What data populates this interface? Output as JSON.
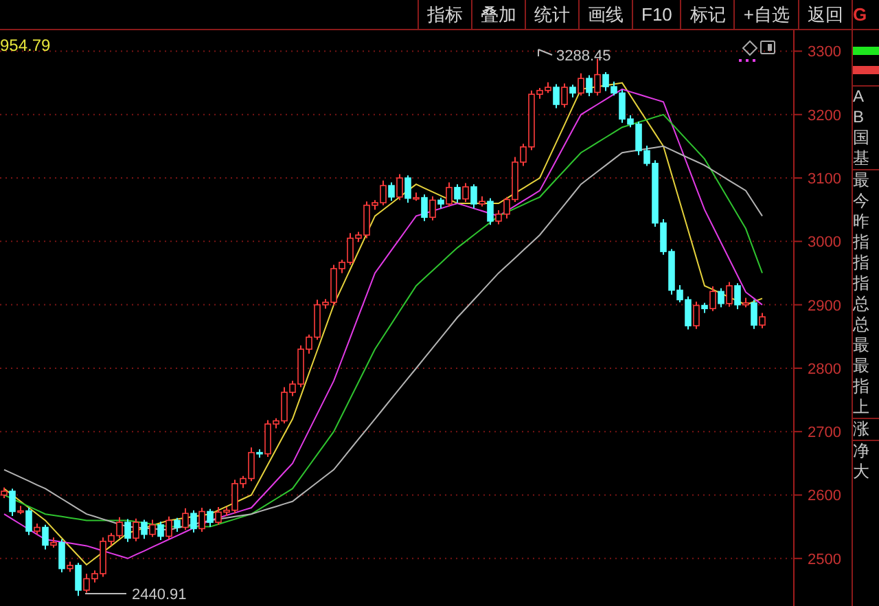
{
  "toolbar": {
    "buttons": [
      "指标",
      "叠加",
      "统计",
      "画线",
      "F10",
      "标记",
      "+自选",
      "返回"
    ]
  },
  "chart": {
    "last_value": "954.79",
    "high_label": "3288.45",
    "low_label": "2440.91",
    "chart_data": {
      "type": "candlestick",
      "grid": true,
      "ylim": [
        2425,
        3333
      ],
      "yticks": [
        {
          "value": 3300,
          "label": "3300"
        },
        {
          "value": 3200,
          "label": "3200"
        },
        {
          "value": 3100,
          "label": "3100"
        },
        {
          "value": 3000,
          "label": "3000"
        },
        {
          "value": 2900,
          "label": "2900"
        },
        {
          "value": 2800,
          "label": "2800"
        },
        {
          "value": 2700,
          "label": "2700"
        },
        {
          "value": 2600,
          "label": "2600"
        },
        {
          "value": 2500,
          "label": "2500"
        }
      ],
      "categories": [
        null,
        null,
        null,
        null,
        null,
        null,
        null,
        null,
        null,
        null,
        null,
        null,
        null,
        null,
        null,
        null,
        null,
        null,
        null,
        null,
        null,
        null,
        null,
        null,
        null,
        null,
        null,
        null,
        null,
        null,
        null,
        null,
        null,
        null,
        null,
        null,
        null,
        null,
        null,
        null,
        null,
        null,
        null,
        null,
        null,
        null,
        null,
        null,
        null,
        null,
        null,
        null,
        null,
        null,
        null,
        null,
        null,
        null,
        null,
        null,
        null,
        null,
        null,
        null,
        null,
        null,
        null,
        null,
        null,
        null,
        null,
        null,
        null,
        null,
        null,
        null,
        null,
        null,
        null,
        null,
        null,
        null,
        null,
        null,
        null,
        null,
        null,
        null,
        null,
        null,
        null,
        null,
        null
      ],
      "ohlc": [
        [
          2600,
          2612,
          2595,
          2606
        ],
        [
          2606,
          2610,
          2567,
          2574
        ],
        [
          2574,
          2583,
          2570,
          2575
        ],
        [
          2575,
          2580,
          2537,
          2543
        ],
        [
          2543,
          2555,
          2538,
          2549
        ],
        [
          2549,
          2553,
          2514,
          2521
        ],
        [
          2521,
          2533,
          2517,
          2525
        ],
        [
          2525,
          2530,
          2478,
          2484
        ],
        [
          2484,
          2495,
          2479,
          2489
        ],
        [
          2489,
          2493,
          2441,
          2450
        ],
        [
          2450,
          2476,
          2446,
          2468
        ],
        [
          2468,
          2481,
          2462,
          2476
        ],
        [
          2476,
          2533,
          2471,
          2527
        ],
        [
          2527,
          2540,
          2520,
          2536
        ],
        [
          2536,
          2565,
          2532,
          2557
        ],
        [
          2557,
          2562,
          2526,
          2532
        ],
        [
          2532,
          2563,
          2527,
          2557
        ],
        [
          2557,
          2561,
          2531,
          2538
        ],
        [
          2538,
          2561,
          2534,
          2553
        ],
        [
          2553,
          2558,
          2529,
          2535
        ],
        [
          2535,
          2566,
          2530,
          2560
        ],
        [
          2560,
          2564,
          2542,
          2549
        ],
        [
          2549,
          2579,
          2545,
          2571
        ],
        [
          2571,
          2576,
          2541,
          2547
        ],
        [
          2547,
          2580,
          2542,
          2574
        ],
        [
          2574,
          2578,
          2550,
          2557
        ],
        [
          2557,
          2581,
          2553,
          2573
        ],
        [
          2573,
          2581,
          2567,
          2576
        ],
        [
          2576,
          2624,
          2571,
          2618
        ],
        [
          2618,
          2630,
          2611,
          2626
        ],
        [
          2626,
          2675,
          2622,
          2667
        ],
        [
          2667,
          2672,
          2659,
          2665
        ],
        [
          2665,
          2718,
          2660,
          2712
        ],
        [
          2712,
          2721,
          2705,
          2717
        ],
        [
          2717,
          2770,
          2713,
          2762
        ],
        [
          2762,
          2780,
          2756,
          2775
        ],
        [
          2775,
          2836,
          2770,
          2830
        ],
        [
          2830,
          2853,
          2823,
          2849
        ],
        [
          2849,
          2908,
          2845,
          2900
        ],
        [
          2900,
          2909,
          2894,
          2904
        ],
        [
          2904,
          2963,
          2899,
          2957
        ],
        [
          2957,
          2971,
          2950,
          2967
        ],
        [
          2967,
          3013,
          2963,
          3005
        ],
        [
          3005,
          3015,
          2999,
          3010
        ],
        [
          3010,
          3063,
          3005,
          3057
        ],
        [
          3057,
          3065,
          3050,
          3061
        ],
        [
          3061,
          3096,
          3057,
          3088
        ],
        [
          3088,
          3093,
          3064,
          3070
        ],
        [
          3070,
          3106,
          3065,
          3100
        ],
        [
          3100,
          3104,
          3061,
          3068
        ],
        [
          3068,
          3077,
          3064,
          3069
        ],
        [
          3069,
          3074,
          3032,
          3038
        ],
        [
          3038,
          3071,
          3033,
          3065
        ],
        [
          3065,
          3069,
          3052,
          3059
        ],
        [
          3059,
          3093,
          3055,
          3085
        ],
        [
          3085,
          3090,
          3061,
          3067
        ],
        [
          3067,
          3092,
          3062,
          3086
        ],
        [
          3086,
          3090,
          3052,
          3059
        ],
        [
          3059,
          3071,
          3055,
          3063
        ],
        [
          3063,
          3068,
          3026,
          3032
        ],
        [
          3032,
          3049,
          3027,
          3043
        ],
        [
          3043,
          3070,
          3036,
          3066
        ],
        [
          3066,
          3133,
          3062,
          3125
        ],
        [
          3125,
          3154,
          3119,
          3149
        ],
        [
          3149,
          3238,
          3144,
          3232
        ],
        [
          3232,
          3242,
          3225,
          3238
        ],
        [
          3238,
          3251,
          3234,
          3243
        ],
        [
          3243,
          3248,
          3210,
          3216
        ],
        [
          3216,
          3249,
          3211,
          3243
        ],
        [
          3243,
          3247,
          3227,
          3234
        ],
        [
          3234,
          3265,
          3230,
          3257
        ],
        [
          3257,
          3262,
          3229,
          3235
        ],
        [
          3235,
          3288,
          3230,
          3263
        ],
        [
          3263,
          3267,
          3237,
          3244
        ],
        [
          3244,
          3252,
          3230,
          3234
        ],
        [
          3234,
          3239,
          3187,
          3193
        ],
        [
          3193,
          3199,
          3180,
          3185
        ],
        [
          3185,
          3189,
          3136,
          3143
        ],
        [
          3143,
          3151,
          3119,
          3123
        ],
        [
          3123,
          3128,
          3023,
          3029
        ],
        [
          3029,
          3035,
          2979,
          2984
        ],
        [
          2984,
          2988,
          2916,
          2923
        ],
        [
          2923,
          2931,
          2904,
          2908
        ],
        [
          2908,
          2913,
          2861,
          2867
        ],
        [
          2867,
          2905,
          2862,
          2899
        ],
        [
          2899,
          2903,
          2887,
          2894
        ],
        [
          2894,
          2929,
          2890,
          2921
        ],
        [
          2921,
          2926,
          2896,
          2902
        ],
        [
          2902,
          2936,
          2897,
          2930
        ],
        [
          2930,
          2934,
          2893,
          2900
        ],
        [
          2900,
          2911,
          2896,
          2903
        ],
        [
          2903,
          2908,
          2862,
          2868
        ],
        [
          2868,
          2887,
          2863,
          2881
        ]
      ],
      "series": [
        {
          "type": "line",
          "color": "#e6d23c",
          "values": [
            2610,
            2600,
            2590,
            2580,
            2570,
            2560,
            2546,
            2532,
            2518,
            2504,
            2490,
            2500,
            2510,
            2520,
            2530,
            2540,
            2544,
            2548,
            2552,
            2556,
            2560,
            2562,
            2564,
            2566,
            2568,
            2570,
            2576,
            2582,
            2588,
            2594,
            2600,
            2624,
            2648,
            2672,
            2696,
            2720,
            2756,
            2792,
            2828,
            2864,
            2900,
            2928,
            2956,
            2984,
            3012,
            3040,
            3050,
            3060,
            3070,
            3080,
            3090,
            3084,
            3078,
            3072,
            3066,
            3060,
            3060,
            3060,
            3060,
            3060,
            3060,
            3068,
            3076,
            3084,
            3092,
            3100,
            3128,
            3156,
            3184,
            3212,
            3240,
            3242,
            3244,
            3246,
            3248,
            3250,
            3230,
            3210,
            3190,
            3170,
            3150,
            3106,
            3062,
            3018,
            2974,
            2930,
            2924,
            2918,
            2912,
            2906,
            2900,
            2905,
            2910
          ]
        },
        {
          "type": "line",
          "color": "#e23be6",
          "values": [
            2570,
            2562,
            2554,
            2546,
            2538,
            2530,
            2528,
            2526,
            2524,
            2522,
            2520,
            2516,
            2512,
            2508,
            2504,
            2500,
            2506,
            2512,
            2518,
            2524,
            2530,
            2536,
            2542,
            2548,
            2554,
            2560,
            2564,
            2568,
            2572,
            2576,
            2580,
            2594,
            2608,
            2622,
            2636,
            2650,
            2676,
            2702,
            2728,
            2754,
            2780,
            2814,
            2848,
            2882,
            2916,
            2950,
            2968,
            2986,
            3004,
            3022,
            3040,
            3044,
            3048,
            3052,
            3056,
            3060,
            3056,
            3052,
            3048,
            3044,
            3040,
            3048,
            3056,
            3064,
            3072,
            3080,
            3104,
            3128,
            3152,
            3176,
            3200,
            3208,
            3216,
            3224,
            3232,
            3240,
            3236,
            3232,
            3228,
            3224,
            3220,
            3186,
            3152,
            3118,
            3084,
            3050,
            3024,
            2998,
            2972,
            2946,
            2920,
            2910,
            2900
          ]
        },
        {
          "type": "line",
          "color": "#2fc42f",
          "values": [
            2600,
            2594,
            2588,
            2582,
            2576,
            2570,
            2568,
            2566,
            2564,
            2562,
            2560,
            2560,
            2560,
            2560,
            2560,
            2560,
            2558,
            2556,
            2554,
            2552,
            2550,
            2550,
            2550,
            2550,
            2550,
            2550,
            2554,
            2558,
            2562,
            2566,
            2570,
            2578,
            2586,
            2594,
            2602,
            2610,
            2628,
            2646,
            2664,
            2682,
            2700,
            2726,
            2752,
            2778,
            2804,
            2830,
            2850,
            2870,
            2890,
            2910,
            2930,
            2942,
            2954,
            2966,
            2978,
            2990,
            3000,
            3010,
            3020,
            3030,
            3040,
            3046,
            3052,
            3058,
            3064,
            3070,
            3084,
            3098,
            3112,
            3126,
            3140,
            3148,
            3156,
            3164,
            3172,
            3180,
            3184,
            3188,
            3192,
            3196,
            3200,
            3186,
            3172,
            3158,
            3144,
            3130,
            3108,
            3086,
            3064,
            3042,
            3020,
            2985,
            2950
          ]
        },
        {
          "type": "line",
          "color": "#b4b4b4",
          "values": [
            2640,
            2634,
            2628,
            2622,
            2616,
            2610,
            2602,
            2594,
            2586,
            2578,
            2570,
            2566,
            2562,
            2558,
            2554,
            2550,
            2549,
            2548,
            2547,
            2546,
            2545,
            2548,
            2551,
            2554,
            2557,
            2560,
            2562,
            2564,
            2566,
            2568,
            2570,
            2574,
            2578,
            2582,
            2586,
            2590,
            2600,
            2610,
            2620,
            2630,
            2640,
            2656,
            2672,
            2688,
            2704,
            2720,
            2736,
            2752,
            2768,
            2784,
            2800,
            2816,
            2832,
            2848,
            2864,
            2880,
            2894,
            2908,
            2922,
            2936,
            2950,
            2962,
            2974,
            2986,
            2998,
            3010,
            3026,
            3042,
            3058,
            3074,
            3090,
            3100,
            3110,
            3120,
            3130,
            3140,
            3142,
            3144,
            3146,
            3148,
            3150,
            3144,
            3138,
            3132,
            3126,
            3120,
            3112,
            3104,
            3096,
            3088,
            3080,
            3060,
            3040
          ]
        }
      ]
    }
  },
  "panel": {
    "code": "G",
    "groups": [
      [
        "A",
        "B",
        "国",
        "基"
      ],
      [
        "最",
        "今",
        "昨",
        "指",
        "指",
        "指",
        "总",
        "总",
        "最",
        "最",
        "指",
        "上"
      ],
      [
        "涨"
      ],
      [
        "净",
        "大"
      ]
    ]
  }
}
